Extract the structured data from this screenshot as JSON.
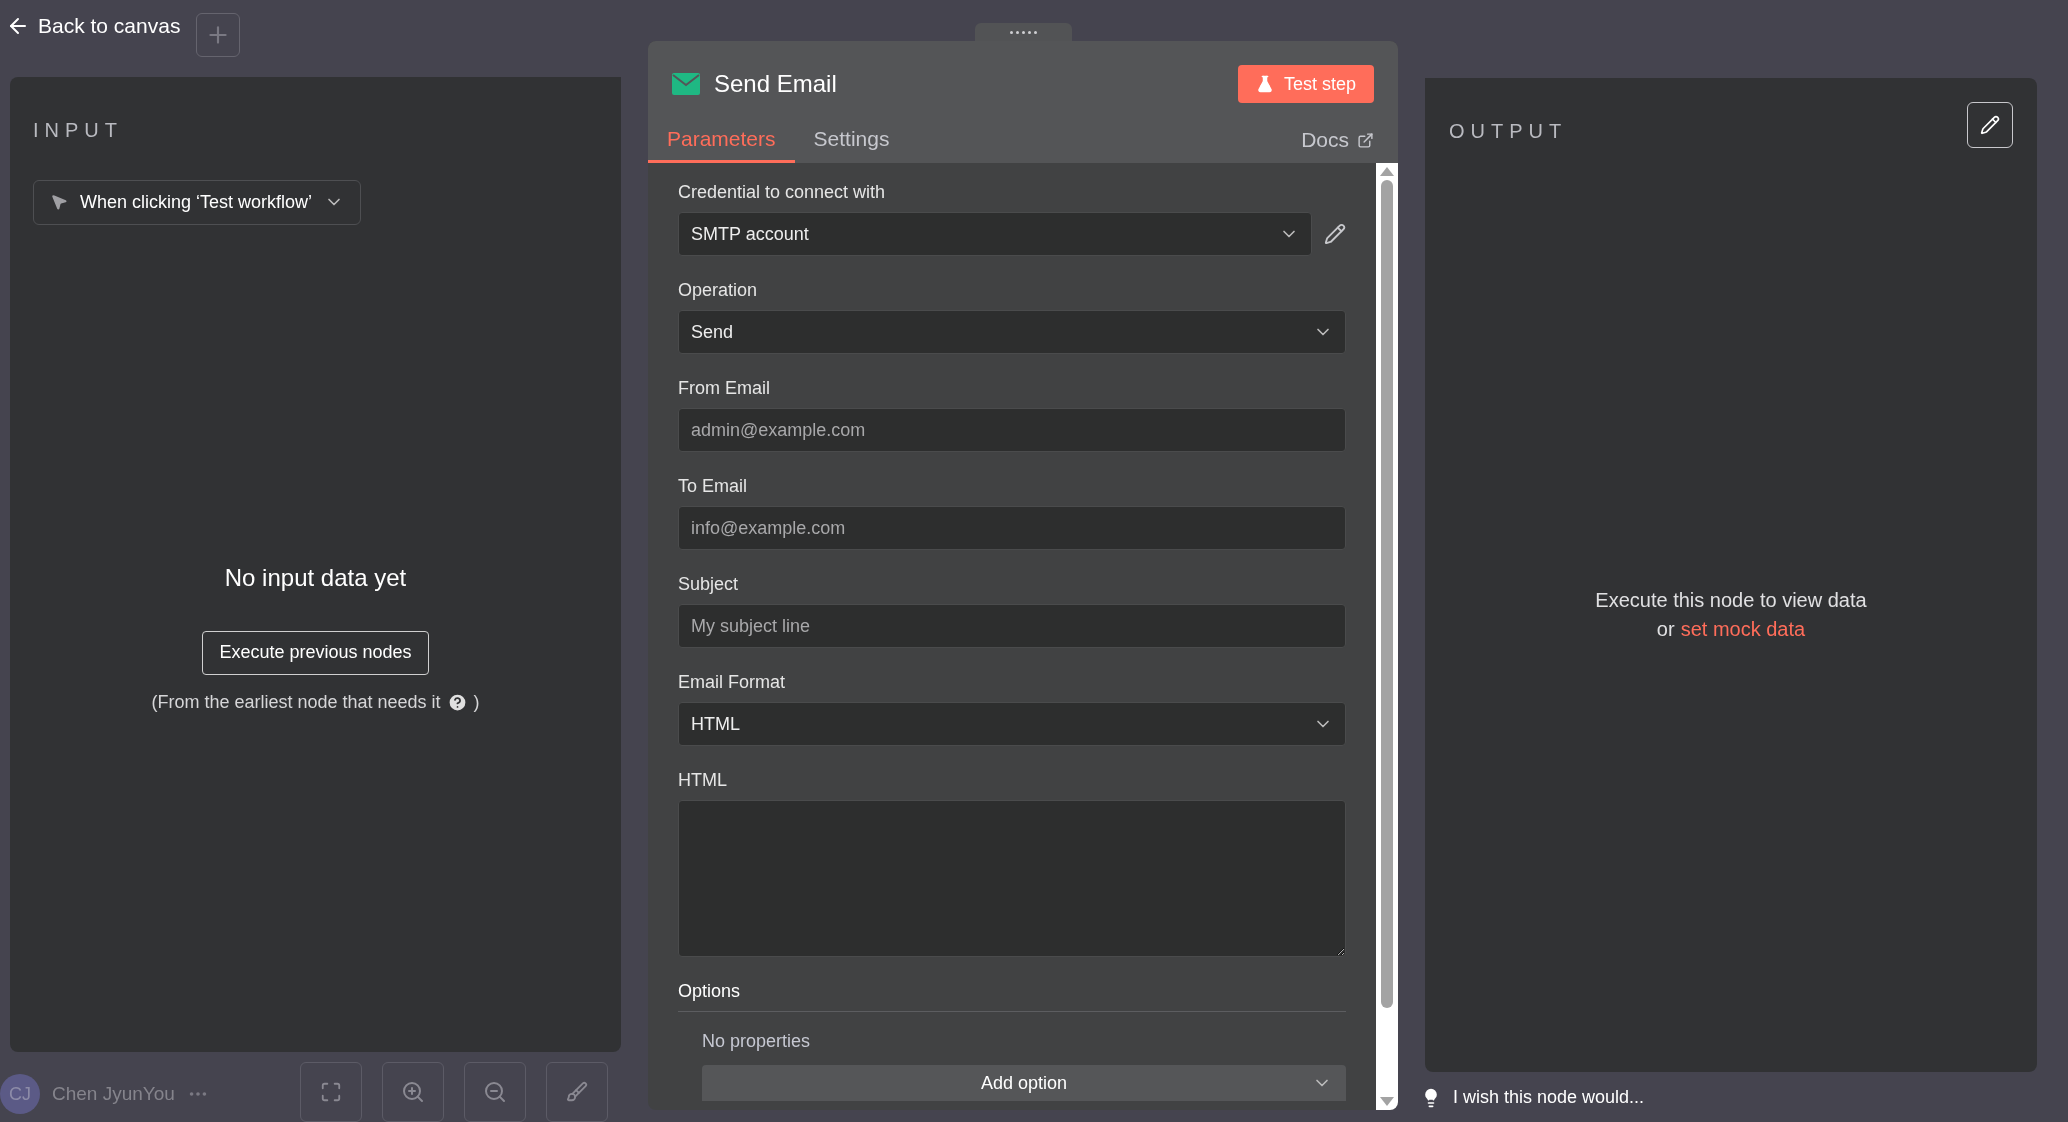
{
  "header": {
    "back_link": "Back to canvas"
  },
  "input": {
    "title": "INPUT",
    "trigger_select": "When clicking ‘Test workflow’",
    "empty_title": "No input data yet",
    "execute_button": "Execute previous nodes",
    "hint": "(From the earliest node that needs it",
    "hint_end": ")"
  },
  "node": {
    "title": "Send Email",
    "test_button": "Test step",
    "docs_link": "Docs",
    "tabs": [
      {
        "label": "Parameters",
        "selected": true
      },
      {
        "label": "Settings",
        "selected": false
      }
    ],
    "fields": [
      {
        "kind": "select",
        "label": "Credential to connect with",
        "value": "SMTP account",
        "editable": true
      },
      {
        "kind": "select",
        "label": "Operation",
        "value": "Send"
      },
      {
        "kind": "text",
        "label": "From Email",
        "placeholder": "admin@example.com"
      },
      {
        "kind": "text",
        "label": "To Email",
        "placeholder": "info@example.com"
      },
      {
        "kind": "text",
        "label": "Subject",
        "placeholder": "My subject line"
      },
      {
        "kind": "select",
        "label": "Email Format",
        "value": "HTML"
      },
      {
        "kind": "textarea",
        "label": "HTML"
      }
    ],
    "options": {
      "label": "Options",
      "empty": "No properties",
      "add_button": "Add option"
    }
  },
  "output": {
    "title": "OUTPUT",
    "message": "Execute this node to view data",
    "mock_prefix": "or",
    "mock_link": "set mock data"
  },
  "user": {
    "initials": "CJ",
    "name": "Chen JyunYou"
  },
  "feedback": "I wish this node would..."
}
